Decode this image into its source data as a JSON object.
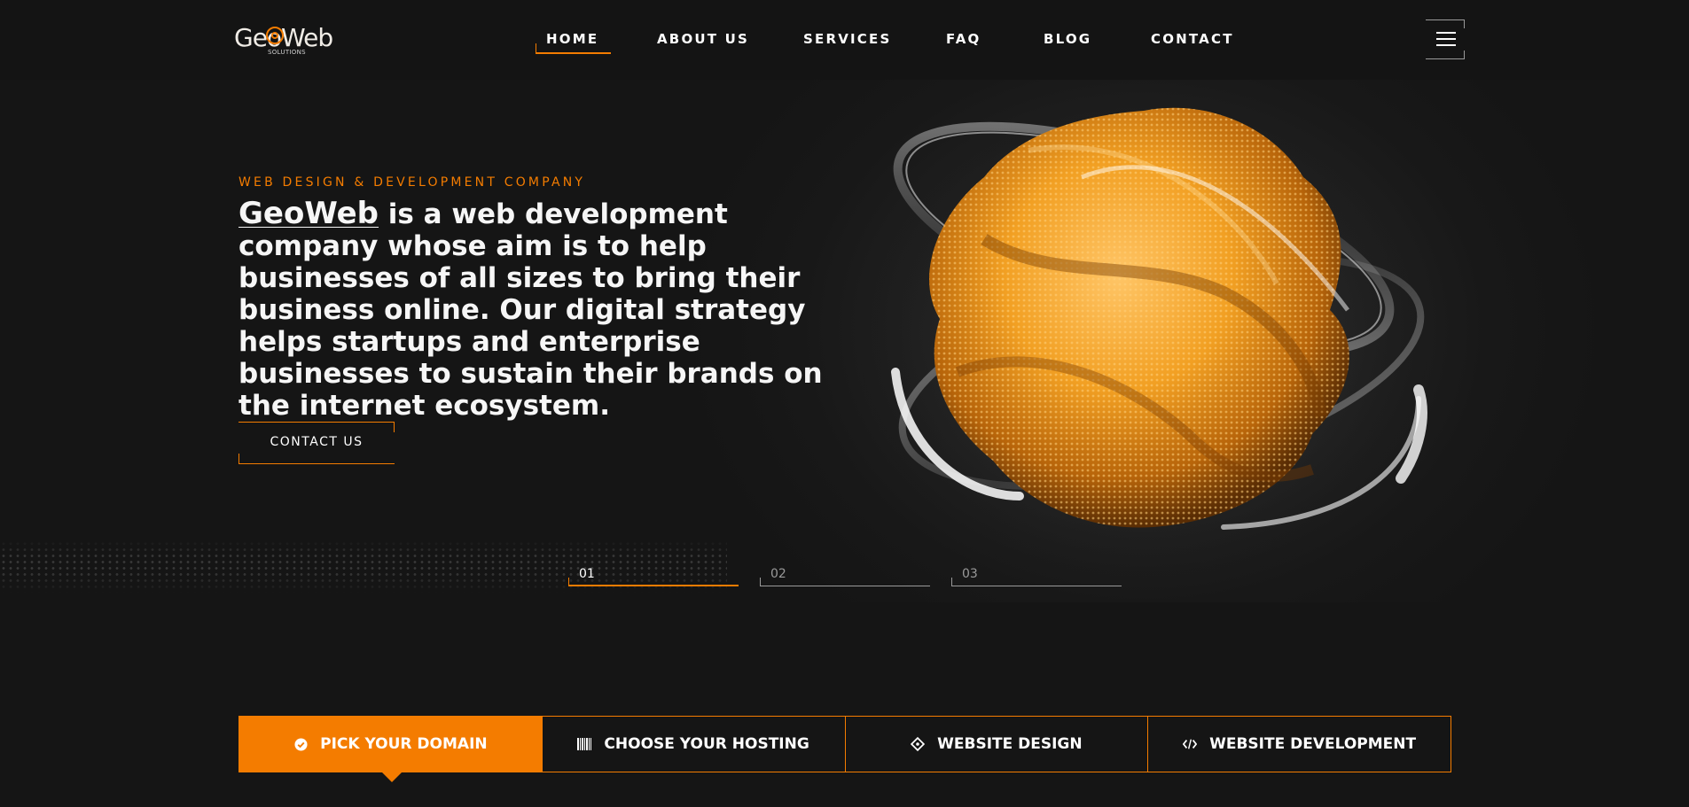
{
  "brand": {
    "logo_text": "GeoWeb",
    "logo_sub": "SOLUTIONS"
  },
  "nav": {
    "items": [
      {
        "label": "HOME",
        "active": true
      },
      {
        "label": "ABOUT US",
        "active": false
      },
      {
        "label": "SERVICES",
        "active": false
      },
      {
        "label": "FAQ",
        "active": false
      },
      {
        "label": "BLOG",
        "active": false
      },
      {
        "label": "CONTACT",
        "active": false
      }
    ],
    "menu_icon": "hamburger-icon"
  },
  "hero": {
    "eyebrow": "WEB DESIGN & DEVELOPMENT COMPANY",
    "headline_brand": "GeoWeb",
    "headline_rest": " is a web development company whose aim is to help businesses of all sizes to bring their business online. Our digital strategy helps startups and enterprise businesses to sustain their brands on the internet ecosystem.",
    "cta_label": "CONTACT US",
    "slides": [
      {
        "label": "01",
        "active": true
      },
      {
        "label": "02",
        "active": false
      },
      {
        "label": "03",
        "active": false
      }
    ]
  },
  "features": {
    "tabs": [
      {
        "label": "PICK YOUR DOMAIN",
        "icon": "check-circle-icon",
        "active": true
      },
      {
        "label": "CHOOSE YOUR HOSTING",
        "icon": "barcode-icon",
        "active": false
      },
      {
        "label": "WEBSITE DESIGN",
        "icon": "design-diamond-icon",
        "active": false
      },
      {
        "label": "WEBSITE DEVELOPMENT",
        "icon": "code-icon",
        "active": false
      }
    ]
  },
  "colors": {
    "accent": "#f47c00",
    "background": "#151515",
    "text": "#ffffff"
  }
}
